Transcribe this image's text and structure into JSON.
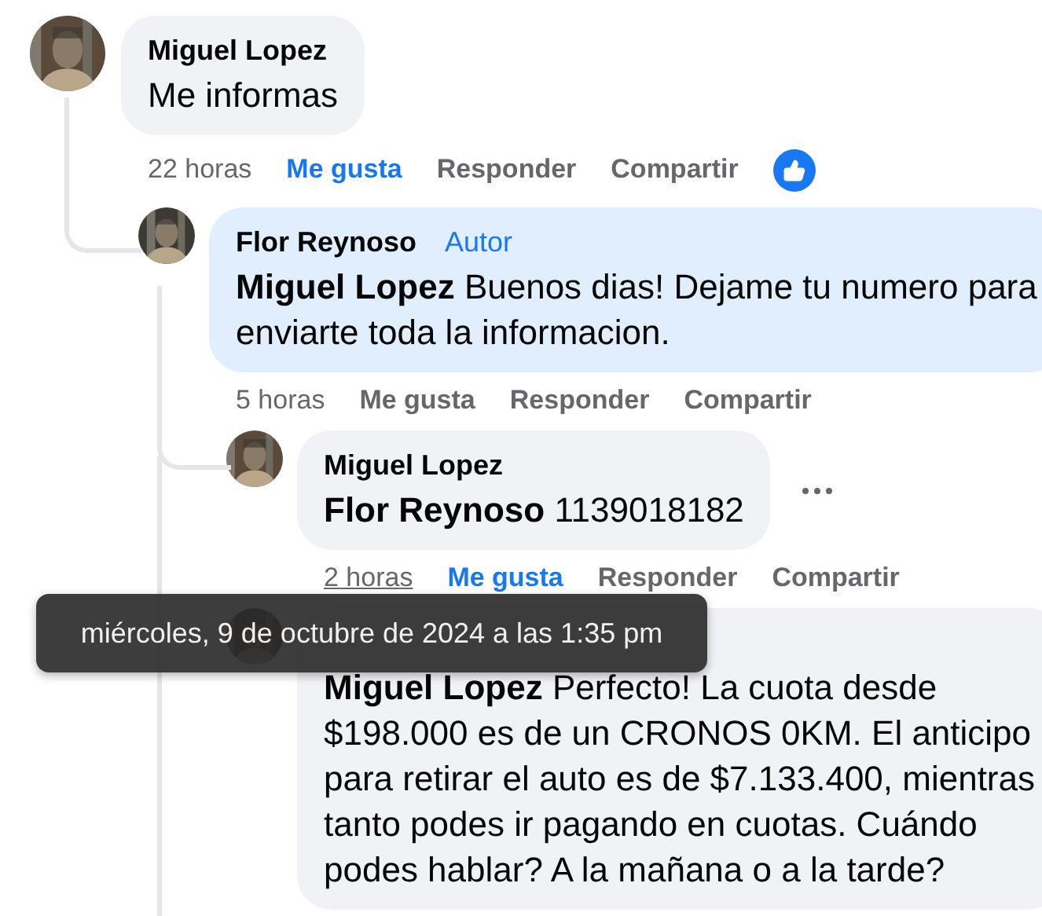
{
  "comments": [
    {
      "author": "Miguel Lopez",
      "body": "Me informas",
      "time": "22 horas",
      "time_hovered": false,
      "like": "Me gusta",
      "liked": true,
      "reply": "Responder",
      "share": "Compartir",
      "like_reaction": true,
      "highlighted": false,
      "menu": false,
      "children": [
        {
          "author": "Flor Reynoso",
          "badge": "Autor",
          "body": "**Miguel Lopez** Buenos dias! Dejame tu numero para\nenviarte toda la informacion.",
          "time": "5 horas",
          "time_hovered": false,
          "like": "Me gusta",
          "liked": false,
          "reply": "Responder",
          "share": "Compartir",
          "like_reaction": false,
          "highlighted": true,
          "menu": false,
          "children": [
            {
              "author": "Miguel Lopez",
              "body": "**Flor Reynoso** 1139018182",
              "time": "2 horas",
              "time_hovered": true,
              "like": "Me gusta",
              "liked": true,
              "reply": "Responder",
              "share": "Compartir",
              "like_reaction": false,
              "highlighted": false,
              "menu": true
            },
            {
              "body": "**Miguel Lopez** Perfecto! La cuota desde\n$198.000 es de un CRONOS 0KM. El anticipo\npara retirar el auto es de $7.133.400, mientras\ntanto podes ir pagando en cuotas. Cuándo\npodes hablar? A la mañana o a la tarde?",
              "highlighted": false
            }
          ]
        }
      ]
    }
  ],
  "tooltip": {
    "text": "miércoles, 9 de octubre de 2024 a las 1:35 pm"
  }
}
